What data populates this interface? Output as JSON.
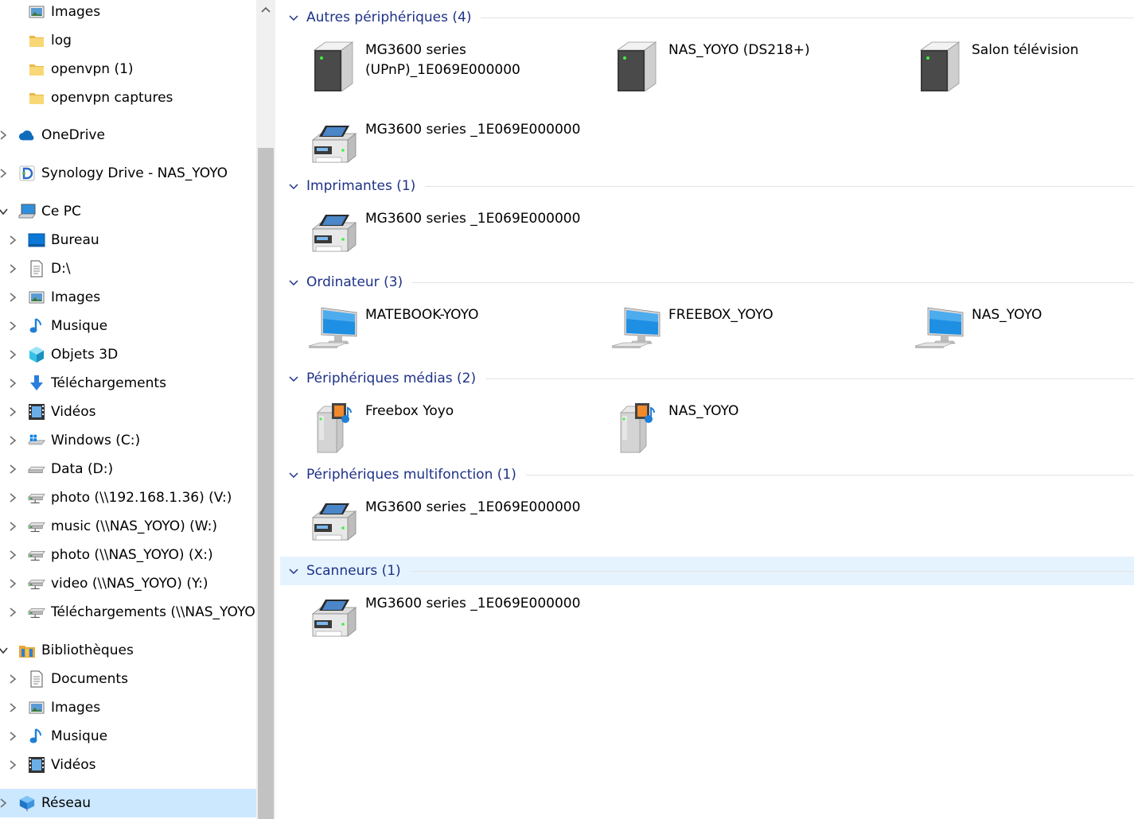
{
  "nav": {
    "items": [
      {
        "label": "Images",
        "icon": "pictures-icon",
        "level": 1,
        "expander": "none"
      },
      {
        "label": "log",
        "icon": "folder-icon",
        "level": 1,
        "expander": "none"
      },
      {
        "label": "openvpn (1)",
        "icon": "folder-icon",
        "level": 1,
        "expander": "none"
      },
      {
        "label": "openvpn captures",
        "icon": "folder-icon",
        "level": 1,
        "expander": "none"
      },
      {
        "label": "OneDrive",
        "icon": "onedrive-icon",
        "level": 0,
        "expander": "collapsed"
      },
      {
        "label": "Synology Drive - NAS_YOYO",
        "icon": "synology-drive-icon",
        "level": 0,
        "expander": "collapsed"
      },
      {
        "label": "Ce PC",
        "icon": "computer-icon",
        "level": 0,
        "expander": "expanded"
      },
      {
        "label": "Bureau",
        "icon": "desktop-icon",
        "level": 1,
        "expander": "collapsed"
      },
      {
        "label": "D:\\",
        "icon": "document-icon",
        "level": 1,
        "expander": "collapsed"
      },
      {
        "label": "Images",
        "icon": "pictures-icon",
        "level": 1,
        "expander": "collapsed"
      },
      {
        "label": "Musique",
        "icon": "music-icon",
        "level": 1,
        "expander": "collapsed"
      },
      {
        "label": "Objets 3D",
        "icon": "objects-3d-icon",
        "level": 1,
        "expander": "collapsed"
      },
      {
        "label": "Téléchargements",
        "icon": "download-icon",
        "level": 1,
        "expander": "collapsed"
      },
      {
        "label": "Vidéos",
        "icon": "video-icon",
        "level": 1,
        "expander": "collapsed"
      },
      {
        "label": "Windows (C:)",
        "icon": "windows-drive-icon",
        "level": 1,
        "expander": "collapsed"
      },
      {
        "label": "Data (D:)",
        "icon": "drive-icon",
        "level": 1,
        "expander": "collapsed"
      },
      {
        "label": "photo (\\\\192.168.1.36) (V:)",
        "icon": "network-drive-icon",
        "level": 1,
        "expander": "collapsed"
      },
      {
        "label": "music (\\\\NAS_YOYO) (W:)",
        "icon": "network-drive-icon",
        "level": 1,
        "expander": "collapsed"
      },
      {
        "label": "photo (\\\\NAS_YOYO) (X:)",
        "icon": "network-drive-icon",
        "level": 1,
        "expander": "collapsed"
      },
      {
        "label": "video (\\\\NAS_YOYO) (Y:)",
        "icon": "network-drive-icon",
        "level": 1,
        "expander": "collapsed"
      },
      {
        "label": "Téléchargements (\\\\NAS_YOYO) (",
        "icon": "network-drive-icon",
        "level": 1,
        "expander": "collapsed"
      },
      {
        "label": "Bibliothèques",
        "icon": "libraries-icon",
        "level": 0,
        "expander": "expanded"
      },
      {
        "label": "Documents",
        "icon": "document-icon",
        "level": 1,
        "expander": "collapsed"
      },
      {
        "label": "Images",
        "icon": "pictures-icon",
        "level": 1,
        "expander": "collapsed"
      },
      {
        "label": "Musique",
        "icon": "music-icon",
        "level": 1,
        "expander": "collapsed"
      },
      {
        "label": "Vidéos",
        "icon": "video-icon",
        "level": 1,
        "expander": "collapsed"
      },
      {
        "label": "Réseau",
        "icon": "network-icon",
        "level": 0,
        "expander": "collapsed",
        "selected": true
      }
    ]
  },
  "groups": [
    {
      "title": "Autres périphériques (4)",
      "items": [
        {
          "label": "MG3600 series\n(UPnP)_1E069E000000",
          "icon": "device-tower-icon"
        },
        {
          "label": "NAS_YOYO (DS218+)",
          "icon": "device-tower-icon"
        },
        {
          "label": "Salon télévision",
          "icon": "device-tower-icon"
        },
        {
          "label": "MG3600 series _1E069E000000",
          "icon": "printer-icon"
        }
      ]
    },
    {
      "title": "Imprimantes (1)",
      "items": [
        {
          "label": "MG3600 series _1E069E000000",
          "icon": "printer-icon"
        }
      ]
    },
    {
      "title": "Ordinateur (3)",
      "items": [
        {
          "label": "MATEBOOK-YOYO",
          "icon": "computer-monitor-icon"
        },
        {
          "label": "FREEBOX_YOYO",
          "icon": "computer-monitor-icon"
        },
        {
          "label": "NAS_YOYO",
          "icon": "computer-monitor-icon"
        }
      ]
    },
    {
      "title": "Périphériques médias (2)",
      "items": [
        {
          "label": "Freebox Yoyo",
          "icon": "media-server-icon"
        },
        {
          "label": "NAS_YOYO",
          "icon": "media-server-icon"
        }
      ]
    },
    {
      "title": "Périphériques multifonction (1)",
      "items": [
        {
          "label": "MG3600 series _1E069E000000",
          "icon": "printer-icon"
        }
      ]
    },
    {
      "title": "Scanneurs (1)",
      "items": [
        {
          "label": "MG3600 series _1E069E000000",
          "icon": "printer-icon"
        }
      ],
      "selected": true
    }
  ],
  "colors": {
    "header_text": "#1e3287",
    "selection": "#cce8ff",
    "hover": "#e5f3ff"
  }
}
